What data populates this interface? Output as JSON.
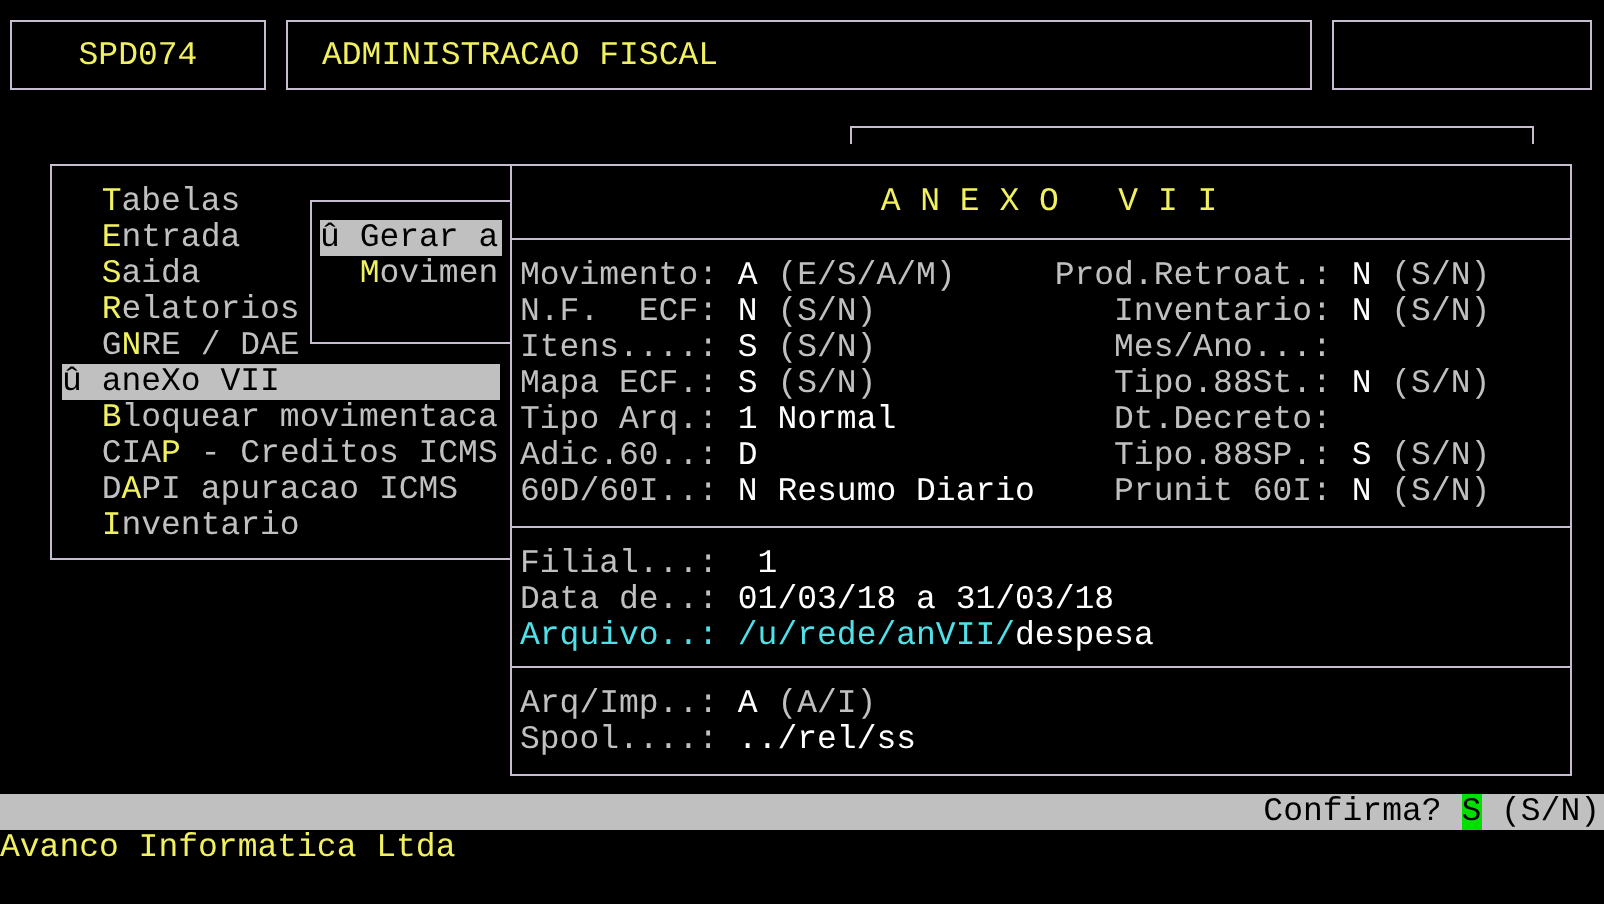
{
  "header": {
    "program": "SPD074",
    "title": "ADMINISTRACAO FISCAL"
  },
  "menu": {
    "items": [
      {
        "key": "T",
        "post": "abelas",
        "selected": false
      },
      {
        "key": "E",
        "post": "ntrada",
        "selected": false
      },
      {
        "key": "S",
        "post": "aida",
        "selected": false
      },
      {
        "key": "R",
        "post": "elatorios",
        "selected": false
      },
      {
        "pre": "G",
        "key": "N",
        "post": "RE / DAE",
        "selected": false
      },
      {
        "marker": "û",
        "pre": "aneXo VII",
        "selected": true
      },
      {
        "key": "B",
        "post": "loquear movimentaca",
        "selected": false
      },
      {
        "pre": "CIA",
        "key": "P",
        "post": " - Creditos ICMS",
        "selected": false
      },
      {
        "pre": "D",
        "key": "A",
        "post": "PI apuracao ICMS",
        "selected": false
      },
      {
        "key": "I",
        "post": "nventario",
        "selected": false
      }
    ]
  },
  "submenu": {
    "items": [
      {
        "marker": "û",
        "pre": "Gerar a",
        "selected": true
      },
      {
        "key": "M",
        "post": "ovimen",
        "selected": false
      }
    ]
  },
  "anexo": {
    "title": "A N E X O   V I I",
    "rows": [
      {
        "left": {
          "label": "Movimento:",
          "value": "A",
          "hint": "(E/S/A/M)"
        },
        "right": {
          "label": "Prod.Retroat.:",
          "value": "N",
          "hint": "(S/N)"
        }
      },
      {
        "left": {
          "label": "N.F.  ECF:",
          "value": "N",
          "hint": "(S/N)"
        },
        "right": {
          "label": "Inventario:",
          "value": "N",
          "hint": "(S/N)"
        }
      },
      {
        "left": {
          "label": "Itens....:",
          "value": "S",
          "hint": "(S/N)"
        },
        "right": {
          "label": "Mes/Ano...:"
        }
      },
      {
        "left": {
          "label": "Mapa ECF.:",
          "value": "S",
          "hint": "(S/N)"
        },
        "right": {
          "label": "Tipo.88St.:",
          "value": "N",
          "hint": "(S/N)"
        }
      },
      {
        "left": {
          "label": "Tipo Arq.:",
          "value": "1 Normal"
        },
        "right": {
          "label": "Dt.Decreto:"
        }
      },
      {
        "left": {
          "label": "Adic.60..:",
          "value": "D"
        },
        "right": {
          "label": "Tipo.88SP.:",
          "value": "S",
          "hint": "(S/N)"
        }
      },
      {
        "left": {
          "label": "60D/60I..:",
          "value": "N Resumo Diario"
        },
        "right": {
          "label": "Prunit 60I:",
          "value": "N",
          "hint": "(S/N)"
        }
      }
    ],
    "filial": {
      "label": "Filial...:",
      "value": "1"
    },
    "data": {
      "label": "Data de..:",
      "value": "01/03/18 a 31/03/18"
    },
    "arquivo": {
      "label": "Arquivo..:",
      "path": "/u/rede/anVII/",
      "file": "despesa"
    },
    "output": [
      {
        "label": "Arq/Imp..:",
        "value": "A",
        "hint": "(A/I)"
      },
      {
        "label": "Spool....:",
        "value": "../rel/ss"
      }
    ]
  },
  "status": {
    "prompt": "Confirma?",
    "answer": "S",
    "hint": "(S/N)"
  },
  "footer": "Avanco Informatica Ltda"
}
